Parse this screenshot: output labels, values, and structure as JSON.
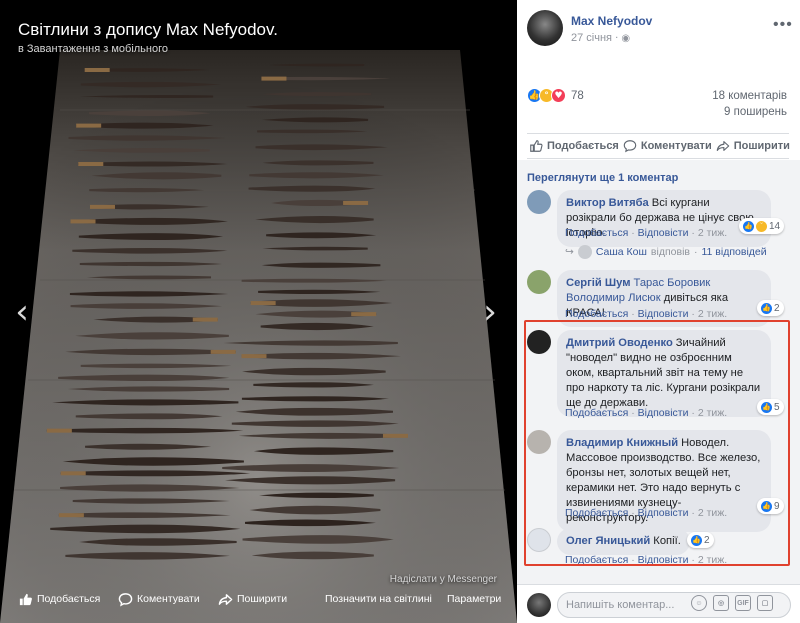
{
  "viewer": {
    "title": "Світлини з допису Max Nefyodov.",
    "subtitle": "в Завантаження з мобільного",
    "messenger": "Надіслати у Messenger",
    "bar": {
      "like": "Подобається",
      "comment": "Коментувати",
      "share": "Поширити",
      "profile_pic": "Позначити на світлині",
      "settings": "Параметри"
    }
  },
  "post": {
    "author": "Max Nefyodov",
    "date": "27 січня",
    "reaction_count": "78",
    "comments_count": "18 коментарів",
    "shares_count": "9 поширень",
    "colors": {
      "like": "#1877f2",
      "wow": "#f7b928",
      "love": "#f33e58"
    }
  },
  "actions": {
    "like": "Подобається",
    "comment": "Коментувати",
    "share": "Поширити"
  },
  "comments": {
    "view_previous": "Переглянути ще 1 коментар",
    "items": [
      {
        "name": "Виктор Витяба",
        "text": "Всі кургани розікрали бо держава не цінує свою історію.",
        "reacts": "14",
        "like": "Подобається",
        "reply": "Відповісти",
        "time": "2 тиж."
      },
      {
        "name": "Сергій Шум",
        "tag": "Тарас Боровик Володимир Лисюк",
        "text": "дивіться яка КРАСА!",
        "reacts": "2",
        "like": "Подобається",
        "reply": "Відповісти",
        "time": "2 тиж."
      },
      {
        "name": "Дмитрий Оводенко",
        "text": "Зичайний \"новодел\" видно не озброєнним оком, квартальний звіт на тему не про наркоту та ліс. Кургани розікрали ще до держави.",
        "reacts": "5",
        "like": "Подобається",
        "reply": "Відповісти",
        "time": "2 тиж."
      },
      {
        "name": "Владимир Книжный",
        "text": "Новодел. Массовое производство. Все железо, бронзы нет, золотых вещей нет, керамики нет. Это надо вернуть с извинениями кузнецу-реконструктору.",
        "reacts": "9",
        "like": "Подобається",
        "reply": "Відповісти",
        "time": "2 тиж."
      },
      {
        "name": "Олег Яницький",
        "text": "Копії.",
        "reacts": "2",
        "like": "Подобається",
        "reply": "Відповісти",
        "time": "2 тиж."
      }
    ],
    "reply_thread": {
      "author": "Саша Кош",
      "verb": "відповів",
      "count": "11 відповідей"
    }
  },
  "compose": {
    "placeholder": "Напишіть коментар..."
  }
}
